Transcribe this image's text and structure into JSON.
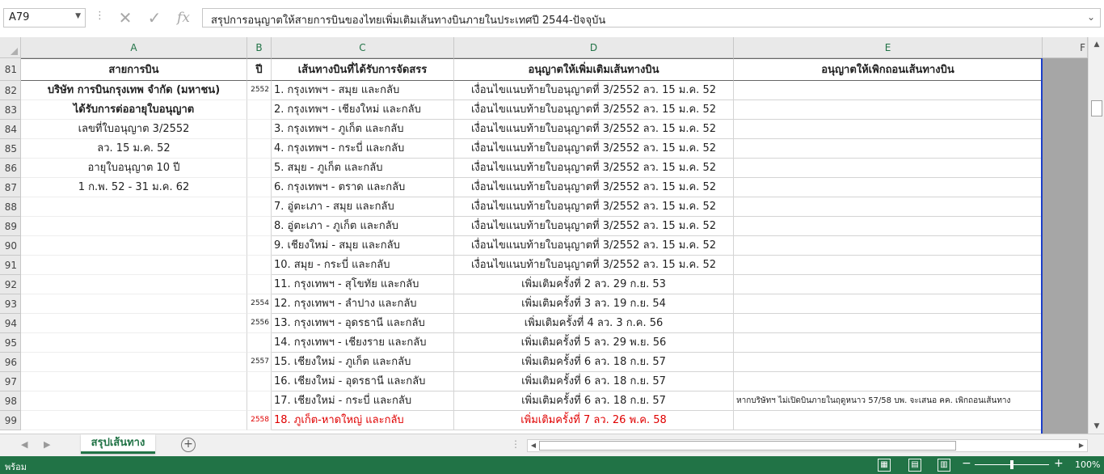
{
  "formula_bar": {
    "name_box": "A79",
    "cancel_icon": "x-icon",
    "enter_icon": "check-icon",
    "function_label": "fx",
    "formula": "สรุปการอนุญาตให้สายการบินของไทยเพิ่มเติมเส้นทางบินภายในประเทศปี 2544-ปัจจุบัน"
  },
  "columns": [
    "A",
    "B",
    "C",
    "D",
    "E",
    "F"
  ],
  "headers": {
    "row": "81",
    "a": "สายการบิน",
    "b": "ปี",
    "c": "เส้นทางบินที่ได้รับการจัดสรร",
    "d": "อนุญาตให้เพิ่มเติมเส้นทางบิน",
    "e": "อนุญาตให้เพิกถอนเส้นทางบิน"
  },
  "rows": [
    {
      "num": "82",
      "a": "บริษัท การบินกรุงเทพ จำกัด (มหาชน)",
      "a_bold": true,
      "b": "2552",
      "c": "1. กรุงเทพฯ - สมุย และกลับ",
      "d": "เงื่อนไขแนบท้ายใบอนุญาตที่ 3/2552 ลว. 15 ม.ค. 52",
      "e": ""
    },
    {
      "num": "83",
      "a": "ได้รับการต่ออายุใบอนุญาต",
      "a_bold": true,
      "b": "",
      "c": "2. กรุงเทพฯ - เชียงใหม่ และกลับ",
      "d": "เงื่อนไขแนบท้ายใบอนุญาตที่ 3/2552 ลว. 15 ม.ค. 52",
      "e": ""
    },
    {
      "num": "84",
      "a": "เลขที่ใบอนุญาต 3/2552",
      "b": "",
      "c": "3. กรุงเทพฯ - ภูเก็ต และกลับ",
      "d": "เงื่อนไขแนบท้ายใบอนุญาตที่ 3/2552 ลว. 15 ม.ค. 52",
      "e": ""
    },
    {
      "num": "85",
      "a": "ลว. 15 ม.ค. 52",
      "b": "",
      "c": "4. กรุงเทพฯ - กระบี่ และกลับ",
      "d": "เงื่อนไขแนบท้ายใบอนุญาตที่ 3/2552 ลว. 15 ม.ค. 52",
      "e": ""
    },
    {
      "num": "86",
      "a": "อายุใบอนุญาต 10 ปี",
      "b": "",
      "c": "5. สมุย - ภูเก็ต และกลับ",
      "d": "เงื่อนไขแนบท้ายใบอนุญาตที่ 3/2552 ลว. 15 ม.ค. 52",
      "e": ""
    },
    {
      "num": "87",
      "a": "1 ก.พ. 52 - 31 ม.ค. 62",
      "b": "",
      "c": "6. กรุงเทพฯ - ตราด และกลับ",
      "d": "เงื่อนไขแนบท้ายใบอนุญาตที่ 3/2552 ลว. 15 ม.ค. 52",
      "e": ""
    },
    {
      "num": "88",
      "a": "",
      "b": "",
      "c": "7. อู่ตะเภา - สมุย และกลับ",
      "d": "เงื่อนไขแนบท้ายใบอนุญาตที่ 3/2552 ลว. 15 ม.ค. 52",
      "e": ""
    },
    {
      "num": "89",
      "a": "",
      "b": "",
      "c": "8. อู่ตะเภา - ภูเก็ต และกลับ",
      "d": "เงื่อนไขแนบท้ายใบอนุญาตที่ 3/2552 ลว. 15 ม.ค. 52",
      "e": ""
    },
    {
      "num": "90",
      "a": "",
      "b": "",
      "c": "9. เชียงใหม่ - สมุย และกลับ",
      "d": "เงื่อนไขแนบท้ายใบอนุญาตที่ 3/2552 ลว. 15 ม.ค. 52",
      "e": ""
    },
    {
      "num": "91",
      "a": "",
      "b": "",
      "c": "10. สมุย - กระบี่ และกลับ",
      "d": "เงื่อนไขแนบท้ายใบอนุญาตที่ 3/2552 ลว. 15 ม.ค. 52",
      "e": ""
    },
    {
      "num": "92",
      "a": "",
      "b": "",
      "c": "11. กรุงเทพฯ - สุโขทัย และกลับ",
      "d": "เพิ่มเติมครั้งที่ 2 ลว. 29 ก.ย. 53",
      "e": ""
    },
    {
      "num": "93",
      "a": "",
      "b": "2554",
      "c": "12. กรุงเทพฯ - ลำปาง และกลับ",
      "d": "เพิ่มเติมครั้งที่ 3 ลว. 19 ก.ย. 54",
      "e": ""
    },
    {
      "num": "94",
      "a": "",
      "b": "2556",
      "c": "13. กรุงเทพฯ - อุดรธานี และกลับ",
      "d": "เพิ่มเติมครั้งที่ 4 ลว. 3 ก.ค. 56",
      "e": ""
    },
    {
      "num": "95",
      "a": "",
      "b": "",
      "c": "14. กรุงเทพฯ - เชียงราย และกลับ",
      "d": "เพิ่มเติมครั้งที่ 5 ลว. 29 พ.ย. 56",
      "e": ""
    },
    {
      "num": "96",
      "a": "",
      "b": "2557",
      "c": "15. เชียงใหม่ - ภูเก็ต และกลับ",
      "d": "เพิ่มเติมครั้งที่ 6 ลว. 18 ก.ย. 57",
      "e": ""
    },
    {
      "num": "97",
      "a": "",
      "b": "",
      "c": "16. เชียงใหม่ - อุดรธานี และกลับ",
      "d": "เพิ่มเติมครั้งที่ 6 ลว. 18 ก.ย. 57",
      "e": ""
    },
    {
      "num": "98",
      "a": "",
      "b": "",
      "c": "17. เชียงใหม่ - กระบี่ และกลับ",
      "d": "เพิ่มเติมครั้งที่ 6 ลว. 18 ก.ย. 57",
      "e": "หากบริษัทฯ ไม่เปิดบินภายในฤดูหนาว 57/58  บพ. จะเสนอ คค. เพิกถอนเส้นทาง"
    },
    {
      "num": "99",
      "a": "",
      "b": "2558",
      "c": "18. ภูเก็ต-หาดใหญ่ และกลับ",
      "d": "เพิ่มเติมครั้งที่ 7 ลว. 26 พ.ค. 58",
      "e": "",
      "red": true
    }
  ],
  "sheet_tab": "สรุปเส้นทาง",
  "add_sheet_icon": "plus-circle-icon",
  "status": {
    "ready": "พร้อม",
    "zoom_minus": "−",
    "zoom_plus": "+",
    "zoom": "100%",
    "zoom_fraction": 0.5
  },
  "colors": {
    "excel_green": "#217346",
    "selection_blue": "#1b3ec9",
    "red_text": "#e00000"
  }
}
